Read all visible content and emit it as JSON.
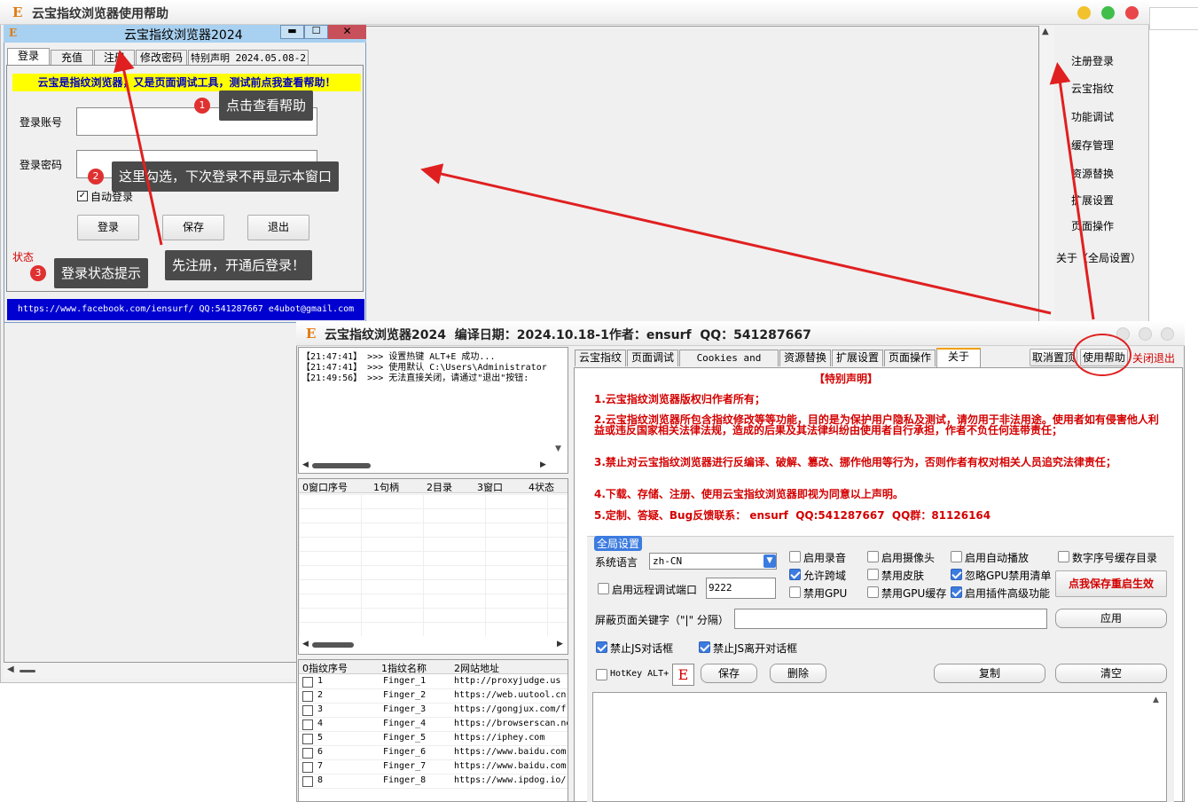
{
  "help_window": {
    "title": "云宝指纹浏览器使用帮助"
  },
  "right_nav": {
    "items": [
      "注册登录",
      "云宝指纹",
      "功能调试",
      "缓存管理",
      "资源替换",
      "扩展设置",
      "页面操作",
      "关于（全局设置）"
    ]
  },
  "login_window": {
    "title": "云宝指纹浏览器2024",
    "tabs": [
      "登录",
      "充值",
      "注册",
      "修改密码",
      "特别声明 2024.05.08-2"
    ],
    "banner": "云宝是指纹浏览器，又是页面调试工具，测试前点我查看帮助！",
    "account_label": "登录账号",
    "password_label": "登录密码",
    "auto_login": "自动登录",
    "buttons": {
      "login": "登录",
      "save": "保存",
      "exit": "退出"
    },
    "status_label": "状态",
    "footer": "https://www.facebook.com/iensurf/ QQ:541287667 e4ubot@gmail.com"
  },
  "callouts": [
    {
      "num": "1",
      "text": "点击查看帮助"
    },
    {
      "num": "2",
      "text": "这里勾选，下次登录不再显示本窗口"
    },
    {
      "num": "3",
      "text": "登录状态提示"
    },
    {
      "num": "",
      "text": "先注册，开通后登录！"
    }
  ],
  "main_window": {
    "title": "云宝指纹浏览器2024  编译日期：2024.10.18-1作者：ensurf  QQ：541287667",
    "logs": [
      "【21:47:41】 >>> 设置热键 ALT+E 成功...",
      "【21:47:41】 >>> 使用默认 C:\\Users\\Administrator",
      "【21:49:56】 >>> 无法直接关闭，请通过\"退出\"按钮:"
    ],
    "window_table_headers": [
      "0窗口序号",
      "1句柄",
      "2目录",
      "3窗口",
      "4状态"
    ],
    "finger_table_headers": [
      "0指纹序号",
      "1指纹名称",
      "2网站地址"
    ],
    "finger_rows": [
      {
        "id": "1",
        "name": "Finger_1",
        "url": "http://proxyjudge.us"
      },
      {
        "id": "2",
        "name": "Finger_2",
        "url": "https://web.uutool.cn"
      },
      {
        "id": "3",
        "name": "Finger_3",
        "url": "https://gongjux.com/f"
      },
      {
        "id": "4",
        "name": "Finger_4",
        "url": "https://browserscan.ne"
      },
      {
        "id": "5",
        "name": "Finger_5",
        "url": "https://iphey.com"
      },
      {
        "id": "6",
        "name": "Finger_6",
        "url": "https://www.baidu.com,"
      },
      {
        "id": "7",
        "name": "Finger_7",
        "url": "https://www.baidu.com,"
      },
      {
        "id": "8",
        "name": "Finger_8",
        "url": "https://www.ipdog.io/"
      }
    ],
    "tabs": [
      "云宝指纹",
      "页面调试",
      "Cookies and Cache",
      "资源替换",
      "扩展设置",
      "页面操作",
      "关于"
    ],
    "cancel_top": "取消置顶",
    "help_button": "使用帮助",
    "close_exit": "关闭退出",
    "statement_title": "【特别声明】",
    "statements": [
      "1.云宝指纹浏览器版权归作者所有；",
      "2.云宝指纹浏览器所包含指纹修改等等功能，目的是为保护用户隐私及测试，请勿用于非法用途。使用者如有侵害他人利益或违反国家相关法律法规，造成的后果及其法律纠纷由使用者自行承担，作者不负任何连带责任；",
      "3.禁止对云宝指纹浏览器进行反编译、破解、篡改、挪作他用等行为，否则作者有权对相关人员追究法律责任；",
      "4.下载、存储、注册、使用云宝指纹浏览器即视为同意以上声明。",
      "5.定制、答疑、Bug反馈联系： ensurf  QQ:541287667  QQ群：81126164"
    ],
    "global": {
      "legend": "全局设置",
      "lang_label": "系统语言",
      "lang_value": "zh-CN",
      "remote_label": "启用远程调试端口",
      "port_value": "9222",
      "checks": [
        {
          "label": "启用录音",
          "on": false
        },
        {
          "label": "启用摄像头",
          "on": false
        },
        {
          "label": "启用自动播放",
          "on": false
        },
        {
          "label": "数字序号缓存目录",
          "on": false
        },
        {
          "label": "允许跨域",
          "on": true
        },
        {
          "label": "禁用皮肤",
          "on": false
        },
        {
          "label": "忽略GPU禁用清单",
          "on": true
        },
        {
          "label": "禁用GPU",
          "on": false
        },
        {
          "label": "禁用GPU缓存",
          "on": false
        },
        {
          "label": "启用插件高级功能",
          "on": true
        }
      ],
      "restart_button": "点我保存重启生效",
      "block_label": "屏蔽页面关键字（\"|\" 分隔）",
      "apply": "应用",
      "disable_js_dialog": "禁止JS对话框",
      "disable_js_leave": "禁止JS离开对话框",
      "hotkey_label": "HotKey ALT+",
      "hotkey_key": "E",
      "save": "保存",
      "delete": "删除",
      "copy": "复制",
      "clear": "清空"
    }
  }
}
